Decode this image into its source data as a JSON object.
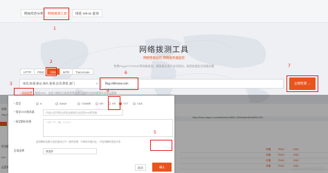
{
  "tabs": [
    "网站综合分析",
    "网络拨测工具",
    "域名 Whois 查询"
  ],
  "hero": {
    "title": "网络拨测工具",
    "subtitle": "网络性能监控  网络服务器监控",
    "desc": "免费Ping/HTTP/DNS等网络拨测，模拟真实用户访问网站，助您快速定位网络问题"
  },
  "protocols": [
    "HTTP",
    "PING",
    "DNS",
    "MTR",
    "Traceroute"
  ],
  "isp_select": {
    "value": "电信,联通,移动,海外,香港,台湾,教育,澳门",
    "caret": "▾"
  },
  "domain_input": {
    "value": "flag.r4khoow.com"
  },
  "query_button": "立即检测 →",
  "advanced": {
    "toggle": "+ 高级配置",
    "hint": "指定DNS、自定义解析记录类型等配置可选择对应的拨测节点和运营商"
  },
  "dialog": {
    "type_label": "* 类型",
    "record_types": [
      "A",
      "AAAA",
      "CNAME",
      "MX",
      "NS",
      "TXT",
      "CAA"
    ],
    "selected_type": "TXT",
    "server_label": "* 指定DNS服务器",
    "server_placeholder": "作者为空时默认使用运营商自动选择dns服务器",
    "resolve_label": "* 指定解析结果",
    "resolve_placeholder": "一行一个，例：1.1.1.1",
    "note": "监测解析结果与设定值对比不一致时告警，不填则不做对比，只检测解析是否可用",
    "region_label": "区域选择",
    "region_value": "请选择",
    "cancel": "取消",
    "confirm": "确认"
  },
  "results": {
    "labels": [
      "结果",
      "flag.r4...",
      "检测模式",
      "ISP",
      "运营商"
    ],
    "url": "https://boce.aliyun.com/detect/dns/d8f5-1480ac5ab4fe4b8f9c7d3f...",
    "row_actions": [
      "详情",
      "PING",
      "DNS"
    ]
  },
  "annotations": [
    "1",
    "2",
    "3",
    "4",
    "5",
    "6",
    "7"
  ],
  "watermark": "CSDN @过气的雷霆",
  "colors": {
    "accent": "#e8541e",
    "annotation": "#e0201b"
  }
}
